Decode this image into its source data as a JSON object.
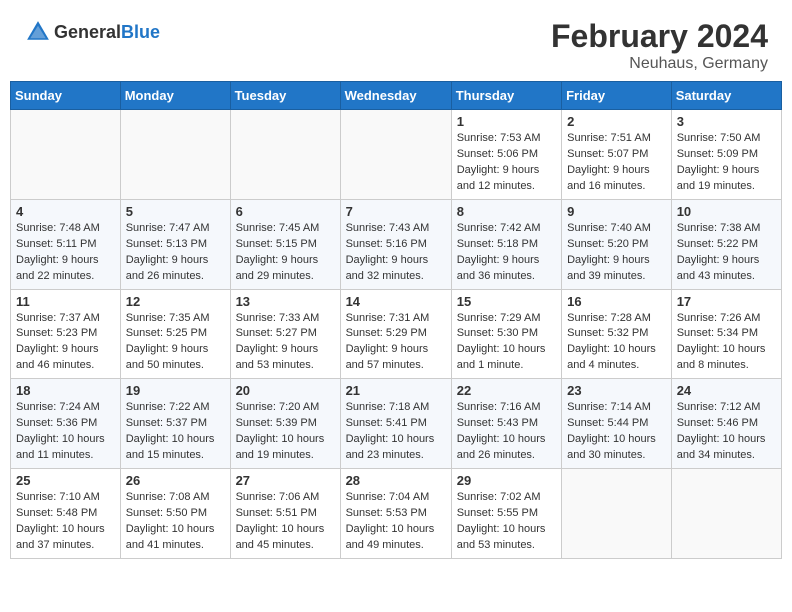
{
  "header": {
    "logo_general": "General",
    "logo_blue": "Blue",
    "title": "February 2024",
    "subtitle": "Neuhaus, Germany"
  },
  "weekdays": [
    "Sunday",
    "Monday",
    "Tuesday",
    "Wednesday",
    "Thursday",
    "Friday",
    "Saturday"
  ],
  "weeks": [
    [
      {
        "day": "",
        "info": ""
      },
      {
        "day": "",
        "info": ""
      },
      {
        "day": "",
        "info": ""
      },
      {
        "day": "",
        "info": ""
      },
      {
        "day": "1",
        "info": "Sunrise: 7:53 AM\nSunset: 5:06 PM\nDaylight: 9 hours\nand 12 minutes."
      },
      {
        "day": "2",
        "info": "Sunrise: 7:51 AM\nSunset: 5:07 PM\nDaylight: 9 hours\nand 16 minutes."
      },
      {
        "day": "3",
        "info": "Sunrise: 7:50 AM\nSunset: 5:09 PM\nDaylight: 9 hours\nand 19 minutes."
      }
    ],
    [
      {
        "day": "4",
        "info": "Sunrise: 7:48 AM\nSunset: 5:11 PM\nDaylight: 9 hours\nand 22 minutes."
      },
      {
        "day": "5",
        "info": "Sunrise: 7:47 AM\nSunset: 5:13 PM\nDaylight: 9 hours\nand 26 minutes."
      },
      {
        "day": "6",
        "info": "Sunrise: 7:45 AM\nSunset: 5:15 PM\nDaylight: 9 hours\nand 29 minutes."
      },
      {
        "day": "7",
        "info": "Sunrise: 7:43 AM\nSunset: 5:16 PM\nDaylight: 9 hours\nand 32 minutes."
      },
      {
        "day": "8",
        "info": "Sunrise: 7:42 AM\nSunset: 5:18 PM\nDaylight: 9 hours\nand 36 minutes."
      },
      {
        "day": "9",
        "info": "Sunrise: 7:40 AM\nSunset: 5:20 PM\nDaylight: 9 hours\nand 39 minutes."
      },
      {
        "day": "10",
        "info": "Sunrise: 7:38 AM\nSunset: 5:22 PM\nDaylight: 9 hours\nand 43 minutes."
      }
    ],
    [
      {
        "day": "11",
        "info": "Sunrise: 7:37 AM\nSunset: 5:23 PM\nDaylight: 9 hours\nand 46 minutes."
      },
      {
        "day": "12",
        "info": "Sunrise: 7:35 AM\nSunset: 5:25 PM\nDaylight: 9 hours\nand 50 minutes."
      },
      {
        "day": "13",
        "info": "Sunrise: 7:33 AM\nSunset: 5:27 PM\nDaylight: 9 hours\nand 53 minutes."
      },
      {
        "day": "14",
        "info": "Sunrise: 7:31 AM\nSunset: 5:29 PM\nDaylight: 9 hours\nand 57 minutes."
      },
      {
        "day": "15",
        "info": "Sunrise: 7:29 AM\nSunset: 5:30 PM\nDaylight: 10 hours\nand 1 minute."
      },
      {
        "day": "16",
        "info": "Sunrise: 7:28 AM\nSunset: 5:32 PM\nDaylight: 10 hours\nand 4 minutes."
      },
      {
        "day": "17",
        "info": "Sunrise: 7:26 AM\nSunset: 5:34 PM\nDaylight: 10 hours\nand 8 minutes."
      }
    ],
    [
      {
        "day": "18",
        "info": "Sunrise: 7:24 AM\nSunset: 5:36 PM\nDaylight: 10 hours\nand 11 minutes."
      },
      {
        "day": "19",
        "info": "Sunrise: 7:22 AM\nSunset: 5:37 PM\nDaylight: 10 hours\nand 15 minutes."
      },
      {
        "day": "20",
        "info": "Sunrise: 7:20 AM\nSunset: 5:39 PM\nDaylight: 10 hours\nand 19 minutes."
      },
      {
        "day": "21",
        "info": "Sunrise: 7:18 AM\nSunset: 5:41 PM\nDaylight: 10 hours\nand 23 minutes."
      },
      {
        "day": "22",
        "info": "Sunrise: 7:16 AM\nSunset: 5:43 PM\nDaylight: 10 hours\nand 26 minutes."
      },
      {
        "day": "23",
        "info": "Sunrise: 7:14 AM\nSunset: 5:44 PM\nDaylight: 10 hours\nand 30 minutes."
      },
      {
        "day": "24",
        "info": "Sunrise: 7:12 AM\nSunset: 5:46 PM\nDaylight: 10 hours\nand 34 minutes."
      }
    ],
    [
      {
        "day": "25",
        "info": "Sunrise: 7:10 AM\nSunset: 5:48 PM\nDaylight: 10 hours\nand 37 minutes."
      },
      {
        "day": "26",
        "info": "Sunrise: 7:08 AM\nSunset: 5:50 PM\nDaylight: 10 hours\nand 41 minutes."
      },
      {
        "day": "27",
        "info": "Sunrise: 7:06 AM\nSunset: 5:51 PM\nDaylight: 10 hours\nand 45 minutes."
      },
      {
        "day": "28",
        "info": "Sunrise: 7:04 AM\nSunset: 5:53 PM\nDaylight: 10 hours\nand 49 minutes."
      },
      {
        "day": "29",
        "info": "Sunrise: 7:02 AM\nSunset: 5:55 PM\nDaylight: 10 hours\nand 53 minutes."
      },
      {
        "day": "",
        "info": ""
      },
      {
        "day": "",
        "info": ""
      }
    ]
  ]
}
